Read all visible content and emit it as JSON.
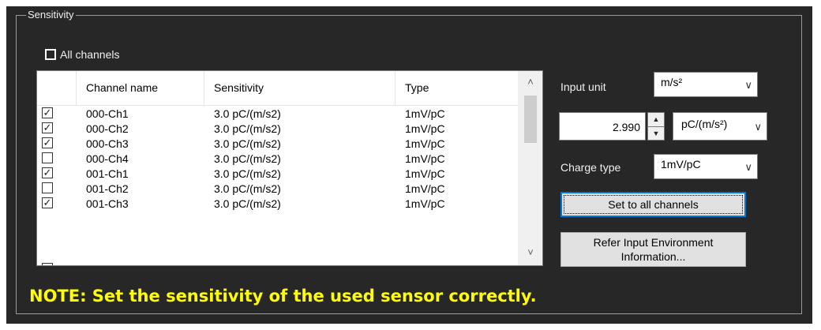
{
  "group_title": "Sensitivity",
  "all_channels_label": "All channels",
  "table": {
    "columns": [
      "Channel name",
      "Sensitivity",
      "Type"
    ],
    "rows": [
      {
        "checked": true,
        "name": "000-Ch1",
        "sensitivity": "3.0 pC/(m/s2)",
        "type": "1mV/pC"
      },
      {
        "checked": true,
        "name": "000-Ch2",
        "sensitivity": "3.0 pC/(m/s2)",
        "type": "1mV/pC"
      },
      {
        "checked": true,
        "name": "000-Ch3",
        "sensitivity": "3.0 pC/(m/s2)",
        "type": "1mV/pC"
      },
      {
        "checked": false,
        "name": "000-Ch4",
        "sensitivity": "3.0 pC/(m/s2)",
        "type": "1mV/pC"
      },
      {
        "checked": true,
        "name": "001-Ch1",
        "sensitivity": "3.0 pC/(m/s2)",
        "type": "1mV/pC"
      },
      {
        "checked": false,
        "name": "001-Ch2",
        "sensitivity": "3.0 pC/(m/s2)",
        "type": "1mV/pC"
      },
      {
        "checked": true,
        "name": "001-Ch3",
        "sensitivity": "3.0 pC/(m/s2)",
        "type": "1mV/pC"
      }
    ]
  },
  "input_unit": {
    "label": "Input unit",
    "value": "m/s²"
  },
  "sensitivity_value": "2.990",
  "sensitivity_unit": "pC/(m/s²)",
  "charge_type": {
    "label": "Charge type",
    "value": "1mV/pC"
  },
  "buttons": {
    "set_all": "Set to all channels",
    "refer_line1": "Refer Input Environment",
    "refer_line2": "Information..."
  },
  "note": "NOTE: Set the sensitivity of the used sensor correctly."
}
